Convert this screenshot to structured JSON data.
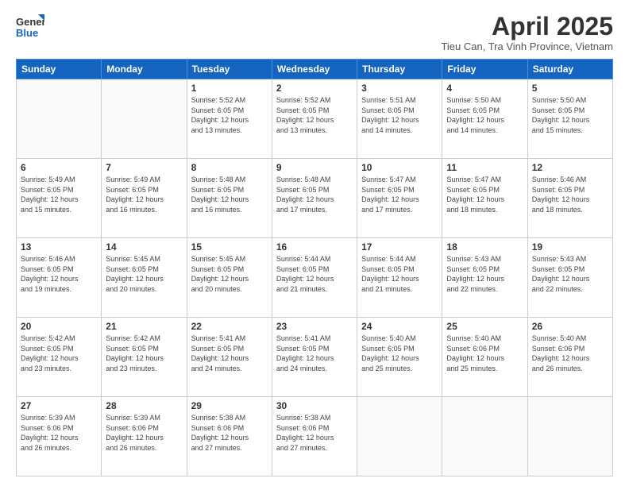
{
  "logo": {
    "general": "General",
    "blue": "Blue"
  },
  "header": {
    "month": "April 2025",
    "location": "Tieu Can, Tra Vinh Province, Vietnam"
  },
  "weekdays": [
    "Sunday",
    "Monday",
    "Tuesday",
    "Wednesday",
    "Thursday",
    "Friday",
    "Saturday"
  ],
  "weeks": [
    [
      {
        "day": "",
        "info": ""
      },
      {
        "day": "",
        "info": ""
      },
      {
        "day": "1",
        "info": "Sunrise: 5:52 AM\nSunset: 6:05 PM\nDaylight: 12 hours\nand 13 minutes."
      },
      {
        "day": "2",
        "info": "Sunrise: 5:52 AM\nSunset: 6:05 PM\nDaylight: 12 hours\nand 13 minutes."
      },
      {
        "day": "3",
        "info": "Sunrise: 5:51 AM\nSunset: 6:05 PM\nDaylight: 12 hours\nand 14 minutes."
      },
      {
        "day": "4",
        "info": "Sunrise: 5:50 AM\nSunset: 6:05 PM\nDaylight: 12 hours\nand 14 minutes."
      },
      {
        "day": "5",
        "info": "Sunrise: 5:50 AM\nSunset: 6:05 PM\nDaylight: 12 hours\nand 15 minutes."
      }
    ],
    [
      {
        "day": "6",
        "info": "Sunrise: 5:49 AM\nSunset: 6:05 PM\nDaylight: 12 hours\nand 15 minutes."
      },
      {
        "day": "7",
        "info": "Sunrise: 5:49 AM\nSunset: 6:05 PM\nDaylight: 12 hours\nand 16 minutes."
      },
      {
        "day": "8",
        "info": "Sunrise: 5:48 AM\nSunset: 6:05 PM\nDaylight: 12 hours\nand 16 minutes."
      },
      {
        "day": "9",
        "info": "Sunrise: 5:48 AM\nSunset: 6:05 PM\nDaylight: 12 hours\nand 17 minutes."
      },
      {
        "day": "10",
        "info": "Sunrise: 5:47 AM\nSunset: 6:05 PM\nDaylight: 12 hours\nand 17 minutes."
      },
      {
        "day": "11",
        "info": "Sunrise: 5:47 AM\nSunset: 6:05 PM\nDaylight: 12 hours\nand 18 minutes."
      },
      {
        "day": "12",
        "info": "Sunrise: 5:46 AM\nSunset: 6:05 PM\nDaylight: 12 hours\nand 18 minutes."
      }
    ],
    [
      {
        "day": "13",
        "info": "Sunrise: 5:46 AM\nSunset: 6:05 PM\nDaylight: 12 hours\nand 19 minutes."
      },
      {
        "day": "14",
        "info": "Sunrise: 5:45 AM\nSunset: 6:05 PM\nDaylight: 12 hours\nand 20 minutes."
      },
      {
        "day": "15",
        "info": "Sunrise: 5:45 AM\nSunset: 6:05 PM\nDaylight: 12 hours\nand 20 minutes."
      },
      {
        "day": "16",
        "info": "Sunrise: 5:44 AM\nSunset: 6:05 PM\nDaylight: 12 hours\nand 21 minutes."
      },
      {
        "day": "17",
        "info": "Sunrise: 5:44 AM\nSunset: 6:05 PM\nDaylight: 12 hours\nand 21 minutes."
      },
      {
        "day": "18",
        "info": "Sunrise: 5:43 AM\nSunset: 6:05 PM\nDaylight: 12 hours\nand 22 minutes."
      },
      {
        "day": "19",
        "info": "Sunrise: 5:43 AM\nSunset: 6:05 PM\nDaylight: 12 hours\nand 22 minutes."
      }
    ],
    [
      {
        "day": "20",
        "info": "Sunrise: 5:42 AM\nSunset: 6:05 PM\nDaylight: 12 hours\nand 23 minutes."
      },
      {
        "day": "21",
        "info": "Sunrise: 5:42 AM\nSunset: 6:05 PM\nDaylight: 12 hours\nand 23 minutes."
      },
      {
        "day": "22",
        "info": "Sunrise: 5:41 AM\nSunset: 6:05 PM\nDaylight: 12 hours\nand 24 minutes."
      },
      {
        "day": "23",
        "info": "Sunrise: 5:41 AM\nSunset: 6:05 PM\nDaylight: 12 hours\nand 24 minutes."
      },
      {
        "day": "24",
        "info": "Sunrise: 5:40 AM\nSunset: 6:05 PM\nDaylight: 12 hours\nand 25 minutes."
      },
      {
        "day": "25",
        "info": "Sunrise: 5:40 AM\nSunset: 6:06 PM\nDaylight: 12 hours\nand 25 minutes."
      },
      {
        "day": "26",
        "info": "Sunrise: 5:40 AM\nSunset: 6:06 PM\nDaylight: 12 hours\nand 26 minutes."
      }
    ],
    [
      {
        "day": "27",
        "info": "Sunrise: 5:39 AM\nSunset: 6:06 PM\nDaylight: 12 hours\nand 26 minutes."
      },
      {
        "day": "28",
        "info": "Sunrise: 5:39 AM\nSunset: 6:06 PM\nDaylight: 12 hours\nand 26 minutes."
      },
      {
        "day": "29",
        "info": "Sunrise: 5:38 AM\nSunset: 6:06 PM\nDaylight: 12 hours\nand 27 minutes."
      },
      {
        "day": "30",
        "info": "Sunrise: 5:38 AM\nSunset: 6:06 PM\nDaylight: 12 hours\nand 27 minutes."
      },
      {
        "day": "",
        "info": ""
      },
      {
        "day": "",
        "info": ""
      },
      {
        "day": "",
        "info": ""
      }
    ]
  ]
}
